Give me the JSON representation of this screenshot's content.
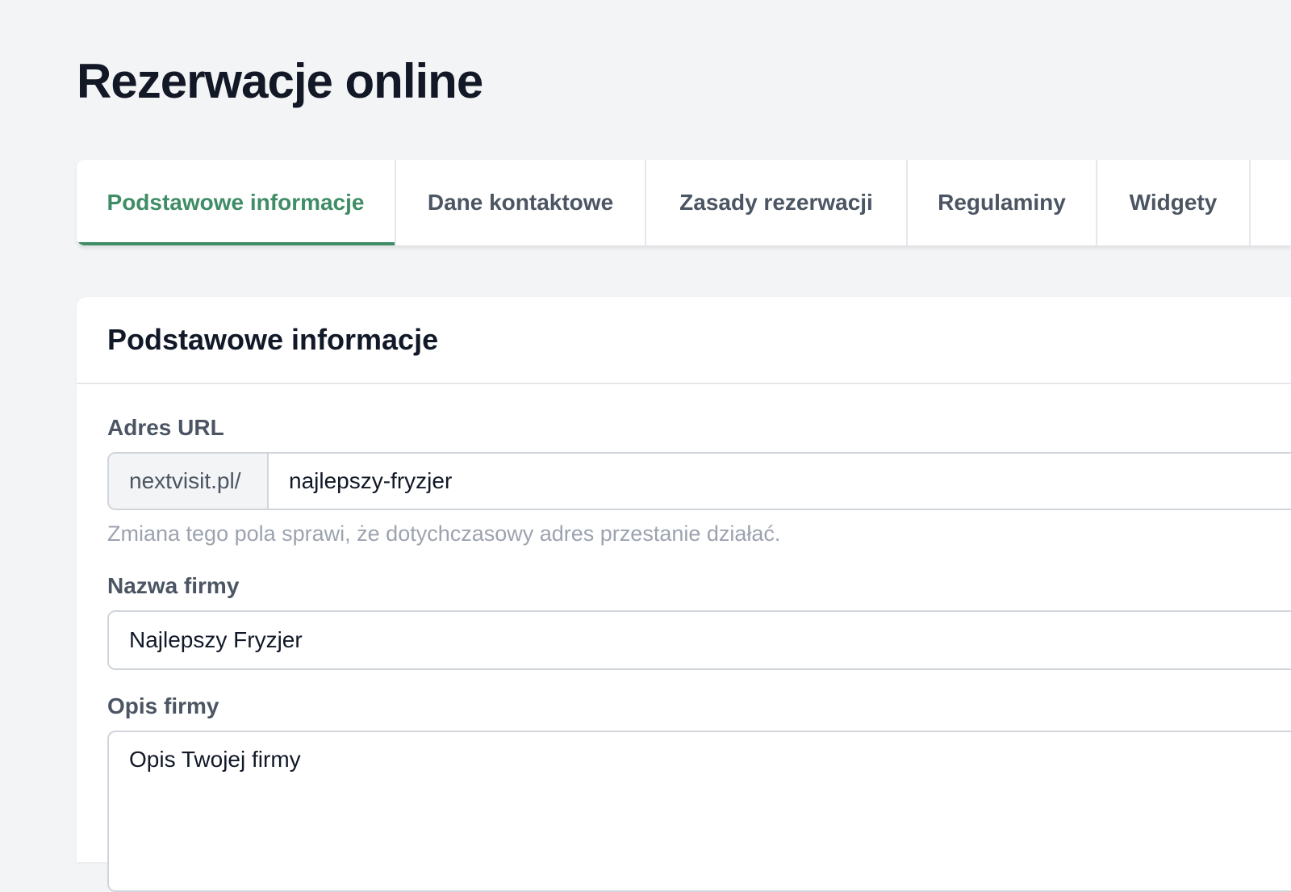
{
  "page": {
    "title": "Rezerwacje online"
  },
  "tabs": [
    {
      "label": "Podstawowe informacje",
      "active": true
    },
    {
      "label": "Dane kontaktowe",
      "active": false
    },
    {
      "label": "Zasady rezerwacji",
      "active": false
    },
    {
      "label": "Regulaminy",
      "active": false
    },
    {
      "label": "Widgety",
      "active": false
    }
  ],
  "card": {
    "title": "Podstawowe informacje",
    "fields": {
      "url": {
        "label": "Adres URL",
        "prefix": "nextvisit.pl/",
        "value": "najlepszy-fryzjer",
        "helper": "Zmiana tego pola sprawi, że dotychczasowy adres przestanie działać."
      },
      "company_name": {
        "label": "Nazwa firmy",
        "value": "Najlepszy Fryzjer"
      },
      "company_description": {
        "label": "Opis firmy",
        "value": "Opis Twojej firmy"
      }
    }
  },
  "colors": {
    "accent": "#3f8d66",
    "background": "#f3f4f6"
  }
}
